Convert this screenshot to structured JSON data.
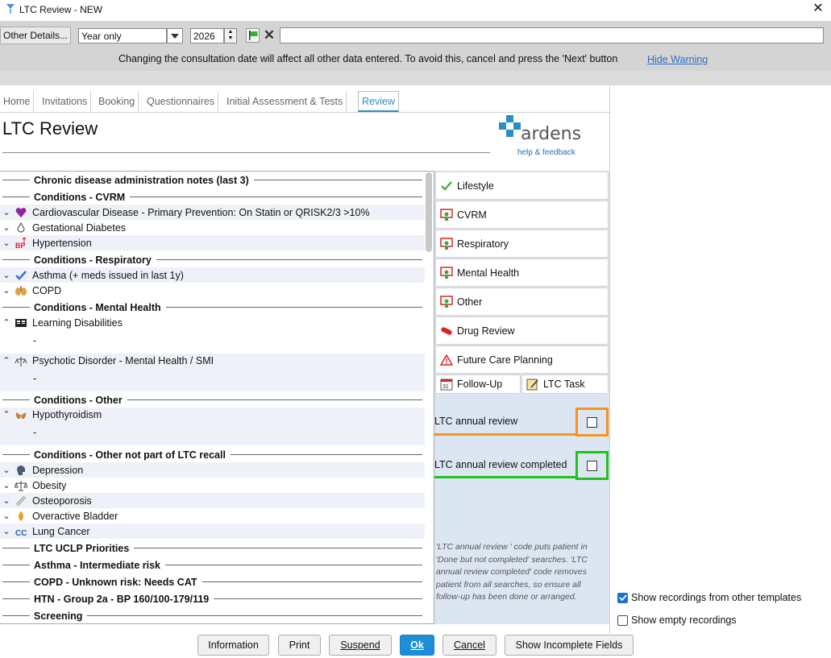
{
  "window": {
    "title": "LTC Review - NEW"
  },
  "toolbar": {
    "other_details": "Other Details...",
    "period": "Year only",
    "year": "2026",
    "free_text": ""
  },
  "warning": {
    "text": "Changing the consultation date will affect all other data entered. To avoid this, cancel and press the 'Next' button",
    "hide_link": "Hide Warning"
  },
  "tabs": [
    "Home",
    "Invitations",
    "Booking",
    "Questionnaires",
    "Initial Assessment & Tests",
    "Review"
  ],
  "page": {
    "title": "LTC Review"
  },
  "brand": {
    "name": "ardens",
    "tagline": "help & feedback"
  },
  "list": {
    "sections": [
      "Chronic disease administration notes (last 3)",
      "Conditions - CVRM",
      "Conditions - Respiratory",
      "Conditions - Mental Health",
      "Conditions - Other",
      "Conditions - Other not part of LTC recall",
      "LTC UCLP Priorities",
      "Asthma - Intermediate risk",
      "COPD - Unknown risk: Needs CAT",
      "HTN - Group 2a - BP 160/100-179/119",
      "Screening"
    ],
    "rows": [
      "Cardiovascular Disease - Primary Prevention: On Statin or QRISK2/3 >10%",
      "Gestational Diabetes",
      "Hypertension",
      "Asthma (+ meds issued in last 1y)",
      "COPD",
      "Learning Disabilities",
      "Psychotic Disorder - Mental Health / SMI",
      "Hypothyroidism",
      "Depression",
      "Obesity",
      "Osteoporosis",
      "Overactive Bladder",
      "Lung Cancer"
    ],
    "dash": "-"
  },
  "nav": {
    "lifestyle": "Lifestyle",
    "cvrm": "CVRM",
    "respiratory": "Respiratory",
    "mental_health": "Mental Health",
    "other": "Other",
    "drug_review": "Drug Review",
    "future_care": "Future Care Planning",
    "follow_up": "Follow-Up",
    "ltc_task": "LTC Task",
    "calendar_day": "31"
  },
  "review": {
    "annual_review": "LTC annual review",
    "annual_review_completed": "LTC annual review completed",
    "note": "'LTC annual review ' code puts patient in 'Done but not completed' searches. 'LTC annual review completed' code removes patient from all searches, so ensure all follow-up has been done or arranged."
  },
  "options": {
    "show_other": "Show recordings from other templates",
    "show_empty": "Show empty recordings"
  },
  "buttons": {
    "information": "Information",
    "print": "Print",
    "suspend": "Suspend",
    "ok": "Ok",
    "cancel": "Cancel",
    "show_incomplete": "Show Incomplete Fields"
  },
  "colors": {
    "accent": "#2a8fc4",
    "ok_button": "#1c8fd8",
    "highlight_orange": "#f7941d",
    "highlight_green": "#1ec21e",
    "right_panel": "#dce6f2"
  }
}
